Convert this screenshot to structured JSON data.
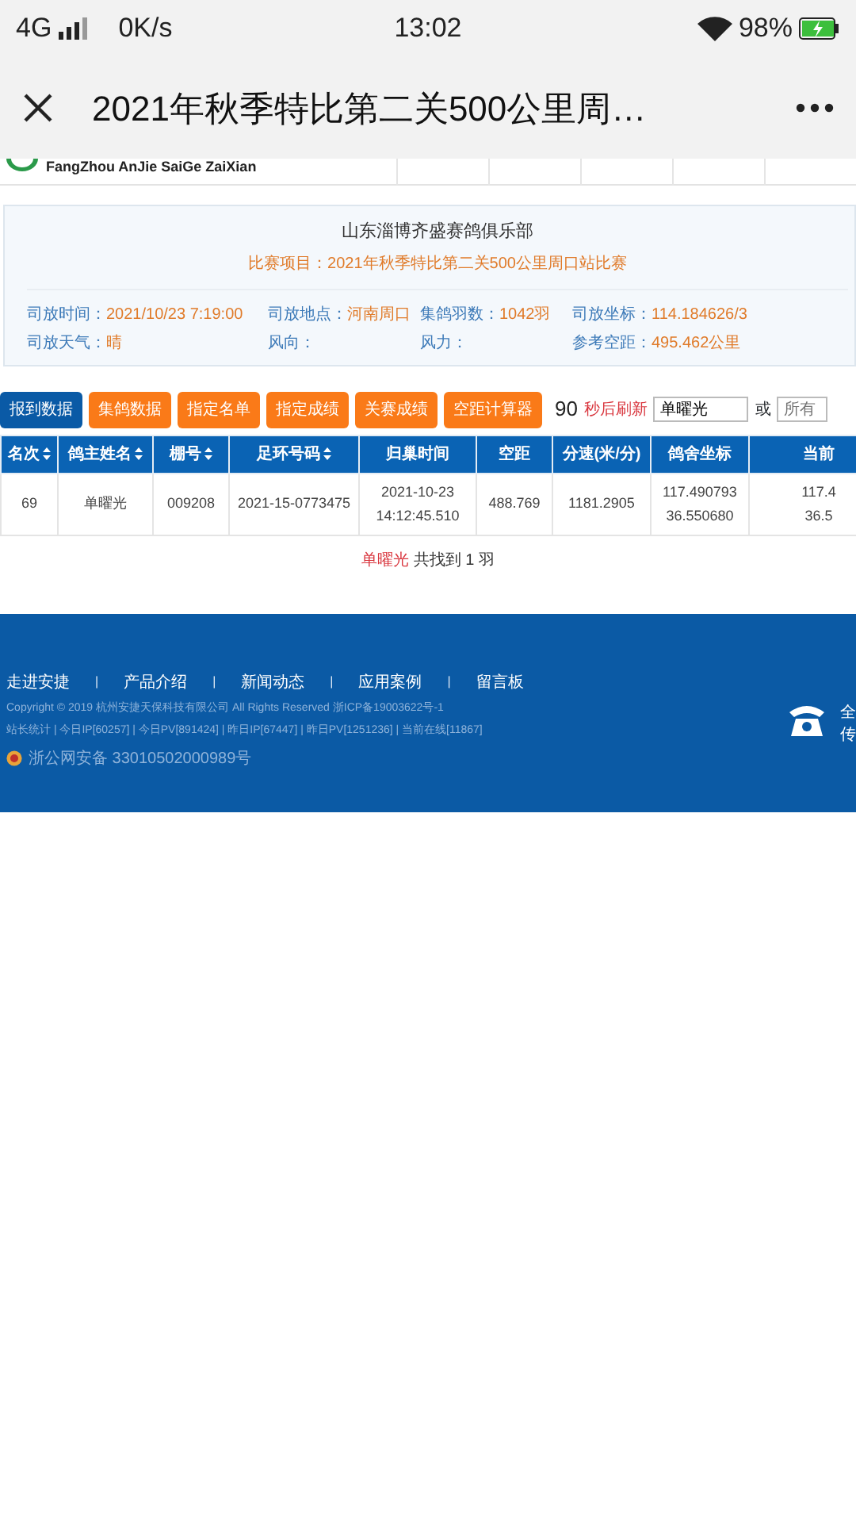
{
  "status_bar": {
    "network": "4G",
    "speed": "0K/s",
    "time": "13:02",
    "battery": "98%",
    "level": 0.98,
    "charging": true
  },
  "nav": {
    "title": "2021年秋季特比第二关500公里周…"
  },
  "site_header": {
    "logo_text": "FangZhou AnJie SaiGe ZaiXian"
  },
  "club": {
    "name": "山东淄博齐盛赛鸽俱乐部",
    "race": "比赛项目：2021年秋季特比第二关500公里周口站比赛"
  },
  "info": [
    {
      "label": "司放时间：",
      "value": "2021/10/23 7:19:00"
    },
    {
      "label": "司放地点：",
      "value": "河南周口"
    },
    {
      "label": "集鸽羽数：",
      "value": "1042羽"
    },
    {
      "label": "司放坐标：",
      "value": "114.184626/3"
    },
    {
      "label": "司放天气：",
      "value": "晴"
    },
    {
      "label": "风向："
    },
    {
      "label": "风力："
    },
    {
      "label": "参考空距：",
      "value": "495.462公里"
    }
  ],
  "tabs": [
    {
      "label": "报到数据",
      "selected": true
    },
    {
      "label": "集鸽数据",
      "selected": false
    },
    {
      "label": "指定名单",
      "selected": false
    },
    {
      "label": "指定成绩",
      "selected": false
    },
    {
      "label": "关赛成绩",
      "selected": false
    },
    {
      "label": "空距计算器",
      "selected": false
    }
  ],
  "countdown": "90",
  "refresh_label": "秒后刷新",
  "search": {
    "value": "单曜光"
  },
  "or_label": "或",
  "filter": {
    "placeholder": "所有"
  },
  "table": {
    "columns": [
      {
        "label": "名次",
        "sortable": true
      },
      {
        "label": "鸽主姓名",
        "sortable": true
      },
      {
        "label": "棚号",
        "sortable": true
      },
      {
        "label": "足环号码",
        "sortable": true
      },
      {
        "label": "归巢时间",
        "sortable": false
      },
      {
        "label": "空距",
        "sortable": false
      },
      {
        "label": "分速(米/分)",
        "sortable": false
      },
      {
        "label": "鸽舍坐标",
        "sortable": false
      },
      {
        "label": "当前",
        "sortable": false
      }
    ],
    "rows": [
      {
        "cells": [
          [
            "69"
          ],
          [
            "单曜光"
          ],
          [
            "009208"
          ],
          [
            "2021-15-0773475"
          ],
          [
            "2021-10-23 14:12:45.510"
          ],
          [
            "488.769"
          ],
          [
            "1181.2905"
          ],
          [
            "117.490793",
            "36.550680"
          ],
          [
            "117.4",
            "36.5"
          ]
        ]
      }
    ]
  },
  "result": {
    "name": "单曜光",
    "text": "共找到 1 羽"
  },
  "footer": {
    "links": [
      "走进安捷",
      "产品介绍",
      "新闻动态",
      "应用案例",
      "留言板"
    ],
    "separator": "|",
    "copyright": "Copyright © 2019 杭州安捷天保科技有限公司 All Rights Reserved 浙ICP备19003622号-1",
    "stats": "站长统计 | 今日IP[60257] | 今日PV[891424] | 昨日IP[67447] | 昨日PV[1251236] | 当前在线[11867]",
    "police": "浙公网安备 33010502000989号",
    "side_texts": [
      "全",
      "传"
    ]
  }
}
